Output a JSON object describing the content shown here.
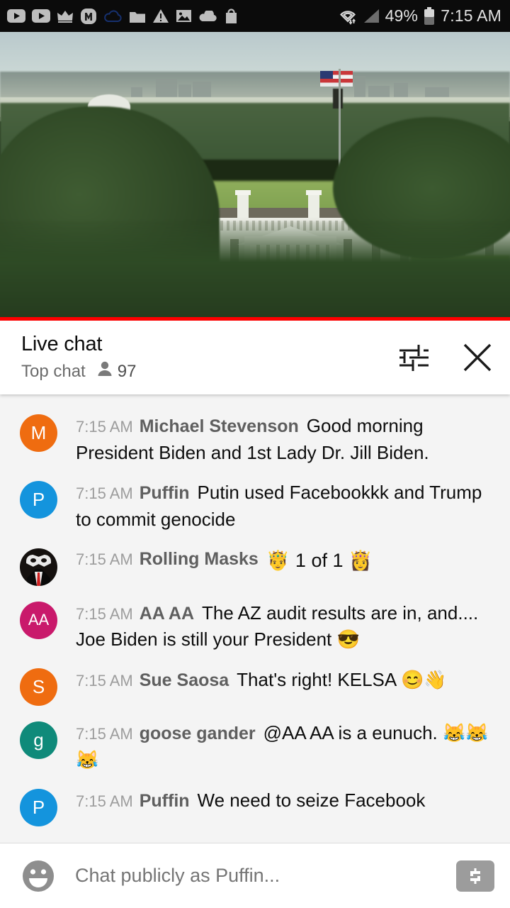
{
  "statusbar": {
    "icons": [
      "youtube-play-icon",
      "youtube-play-icon-2",
      "crown-icon",
      "m-badge-icon",
      "cloud-outline-icon",
      "folder-icon",
      "warning-triangle-icon",
      "photo-icon",
      "cloud-filled-icon",
      "shopping-bag-icon"
    ],
    "wifi_icon": "wifi-data-icon",
    "signal_icon": "cell-signal-icon",
    "battery_percent": "49%",
    "battery_icon": "battery-icon",
    "clock": "7:15 AM"
  },
  "video": {
    "name": "white-house-live-stream",
    "live_progress_color": "#ff0000"
  },
  "chat_header": {
    "title": "Live chat",
    "subtitle": "Top chat",
    "viewer_icon": "person-icon",
    "viewer_count": "97",
    "settings_icon": "tune-icon",
    "close_icon": "close-icon"
  },
  "messages": [
    {
      "avatar_letter": "M",
      "avatar_color": "#ef6c10",
      "avatar_type": "letter",
      "timestamp": "7:15 AM",
      "author": "Michael Stevenson",
      "text": "Good morning President Biden and 1st Lady Dr. Jill Biden."
    },
    {
      "avatar_letter": "P",
      "avatar_color": "#1494dd",
      "avatar_type": "letter",
      "timestamp": "7:15 AM",
      "author": "Puffin",
      "text": "Putin used Facebookkk and Trump to commit genocide"
    },
    {
      "avatar_letter": "",
      "avatar_color": "#15110f",
      "avatar_type": "masquerade-photo",
      "timestamp": "7:15 AM",
      "author": "Rolling Masks",
      "text": "🤴 1 of 1 👸"
    },
    {
      "avatar_letter": "AA",
      "avatar_color": "#c9196b",
      "avatar_type": "letter",
      "timestamp": "7:15 AM",
      "author": "AA AA",
      "text": "The AZ audit results are in, and.... Joe Biden is still your President 😎"
    },
    {
      "avatar_letter": "S",
      "avatar_color": "#ef6c10",
      "avatar_type": "letter",
      "timestamp": "7:15 AM",
      "author": "Sue Saosa",
      "text": "That's right! KELSA 😊👋"
    },
    {
      "avatar_letter": "g",
      "avatar_color": "#0f8a7a",
      "avatar_type": "letter",
      "timestamp": "7:15 AM",
      "author": "goose gander",
      "text": "@AA AA is a eunuch. 😹😹😹"
    },
    {
      "avatar_letter": "P",
      "avatar_color": "#1494dd",
      "avatar_type": "letter",
      "timestamp": "7:15 AM",
      "author": "Puffin",
      "text": "We need to seize Facebook"
    }
  ],
  "input_bar": {
    "emoji_icon": "emoji-smiley-icon",
    "placeholder": "Chat publicly as Puffin...",
    "superchat_icon": "dollar-superchat-icon"
  },
  "colors": {
    "chat_bg": "#f4f4f4",
    "header_bg": "#ffffff",
    "live_red": "#ff0000"
  }
}
